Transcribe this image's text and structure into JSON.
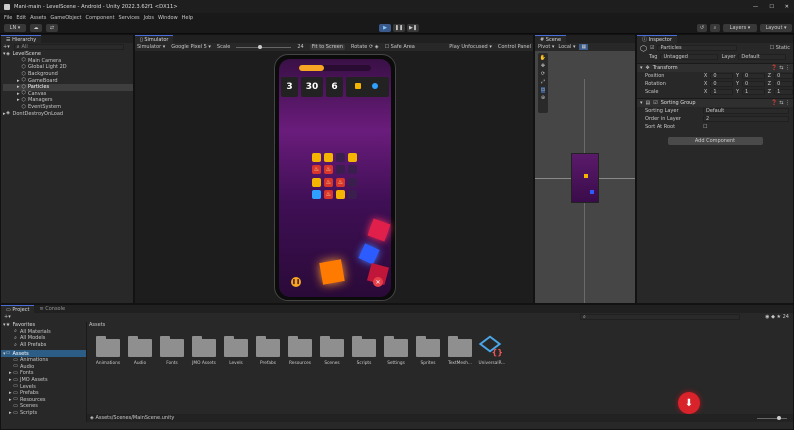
{
  "window": {
    "title": "Mani-main - LevelScene - Android - Unity 2022.3.62f1 <DX11>"
  },
  "menu": [
    "File",
    "Edit",
    "Assets",
    "GameObject",
    "Component",
    "Services",
    "Jobs",
    "Window",
    "Help"
  ],
  "toolbar": {
    "account": "LN",
    "layers": "Layers",
    "layout": "Layout"
  },
  "hierarchy": {
    "tab": "Hierarchy",
    "search_placeholder": "All",
    "scene": "LevelScene",
    "items": [
      "Main Camera",
      "Global Light 2D",
      "Background",
      "GameBoard",
      "Particles",
      "Canvas",
      "Managers",
      "EventSystem"
    ],
    "dontdestroy": "DontDestroyOnLoad"
  },
  "simulator": {
    "tab": "Simulator",
    "mode": "Simulator",
    "device": "Google Pixel 5",
    "scale_label": "Scale",
    "scale_value": "24",
    "fit": "Fit to Screen",
    "rotate": "Rotate",
    "safe_area": "Safe Area",
    "play_mode": "Play Unfocused",
    "control_panel": "Control Panel"
  },
  "game": {
    "stat1": "3",
    "stat2": "30",
    "stat3": "6"
  },
  "scene": {
    "tab": "Scene",
    "pivot": "Pivot",
    "local": "Local"
  },
  "inspector": {
    "tab": "Inspector",
    "name": "Particles",
    "static": "Static",
    "tag_label": "Tag",
    "tag": "Untagged",
    "layer_label": "Layer",
    "layer": "Default",
    "transform": "Transform",
    "position": {
      "label": "Position",
      "x": "0",
      "y": "0",
      "z": "0"
    },
    "rotation": {
      "label": "Rotation",
      "x": "0",
      "y": "0",
      "z": "0"
    },
    "scale": {
      "label": "Scale",
      "x": "1",
      "y": "1",
      "z": "1"
    },
    "sorting_group": "Sorting Group",
    "sorting_layer": {
      "label": "Sorting Layer",
      "value": "Default"
    },
    "order": {
      "label": "Order in Layer",
      "value": "2"
    },
    "sort_root": {
      "label": "Sort At Root"
    },
    "add_component": "Add Component"
  },
  "project": {
    "tab1": "Project",
    "tab2": "Console",
    "favorites": "Favorites",
    "fav_items": [
      "All Materials",
      "All Models",
      "All Prefabs"
    ],
    "assets_root": "Assets",
    "tree": [
      "Animations",
      "Audio",
      "Fonts",
      "JMO Assets",
      "Levels",
      "Prefabs",
      "Resources",
      "Scenes",
      "Scripts"
    ],
    "breadcrumb": "Assets",
    "folders": [
      "Animations",
      "Audio",
      "Fonts",
      "JMO Assets",
      "Levels",
      "Prefabs",
      "Resources",
      "Scenes",
      "Scripts",
      "Settings",
      "Sprites",
      "TextMesh...",
      "UniversalR..."
    ],
    "path": "Assets/Scenes/MainScene.unity",
    "badge": "24"
  }
}
